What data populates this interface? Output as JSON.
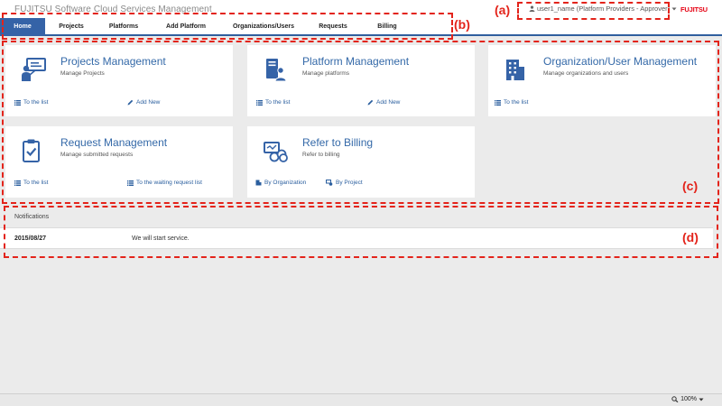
{
  "app": {
    "title": "FUJITSU Software Cloud Services Management",
    "logo_text": "FUJITSU"
  },
  "user_menu": {
    "label": "user1_name (Platform Providers - Approver)",
    "icon": "user-icon"
  },
  "nav": {
    "tabs": [
      {
        "label": "Home",
        "active": true
      },
      {
        "label": "Projects"
      },
      {
        "label": "Platforms"
      },
      {
        "label": "Add Platform"
      },
      {
        "label": "Organizations/Users"
      },
      {
        "label": "Requests"
      },
      {
        "label": "Billing"
      }
    ]
  },
  "cards": {
    "projects": {
      "title": "Projects Management",
      "desc": "Manage Projects",
      "link1": "To the list",
      "link2": "Add New",
      "icon": "presentation-icon"
    },
    "platforms": {
      "title": "Platform Management",
      "desc": "Manage platforms",
      "link1": "To the list",
      "link2": "Add New",
      "icon": "platform-user-icon"
    },
    "orgs": {
      "title": "Organization/User Management",
      "desc": "Manage organizations and users",
      "link1": "To the list",
      "icon": "building-icon"
    },
    "requests": {
      "title": "Request Management",
      "desc": "Manage submitted requests",
      "link1": "To the list",
      "link2": "To the waiting request list",
      "icon": "clipboard-check-icon"
    },
    "billing": {
      "title": "Refer to Billing",
      "desc": "Refer to billing",
      "link1": "By Organization",
      "link2": "By Project",
      "icon": "billing-icon"
    }
  },
  "notifications": {
    "header": "Notifications",
    "items": [
      {
        "date": "2015/08/27",
        "message": "We will start service."
      }
    ]
  },
  "annotations": {
    "a": "(a)",
    "b": "(b)",
    "c": "(c)",
    "d": "(d)"
  },
  "status": {
    "zoom": "100%"
  },
  "colors": {
    "accent": "#3563a7",
    "link": "#2a5e9e",
    "annotation": "#e3241b",
    "logo": "#e60012"
  }
}
